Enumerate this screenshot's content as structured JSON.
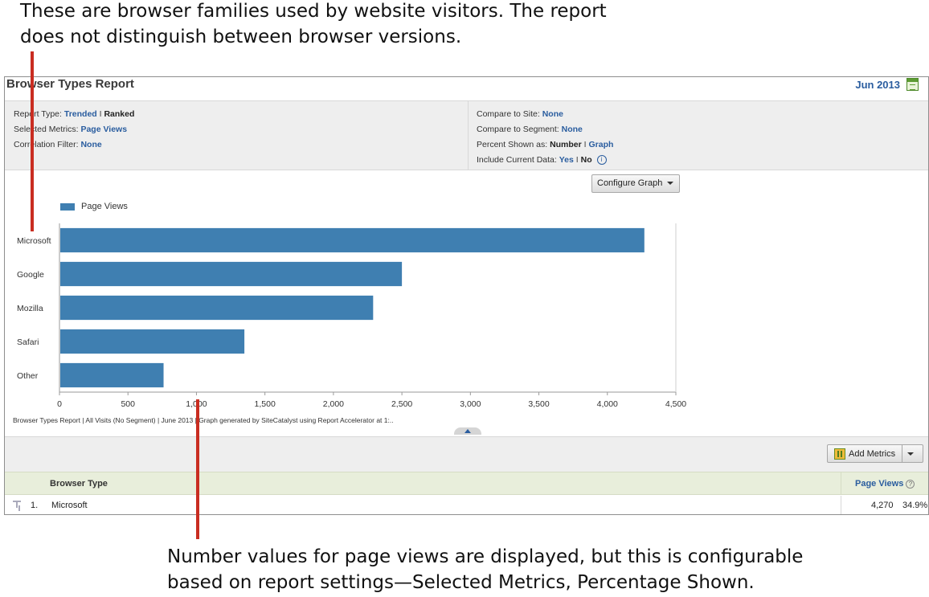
{
  "callouts": {
    "top_line1": "These are browser families used by website visitors. The report",
    "top_line2": "does not distinguish between browser versions.",
    "bottom_line1": "Number values for page views are displayed, but this is configurable",
    "bottom_line2": "based on report settings—Selected Metrics, Percentage Shown."
  },
  "report": {
    "title": "Browser Types Report",
    "date": "Jun 2013",
    "calendar_icon": "calendar-icon"
  },
  "settings": {
    "report_type_label": "Report Type:",
    "report_type_trended": "Trended",
    "report_type_sep": " I ",
    "report_type_ranked": "Ranked",
    "selected_metrics_label": "Selected Metrics:",
    "selected_metrics_value": "Page Views",
    "correlation_filter_label": "Correlation Filter:",
    "correlation_filter_value": "None",
    "compare_site_label": "Compare to Site:",
    "compare_site_value": "None",
    "compare_segment_label": "Compare to Segment:",
    "compare_segment_value": "None",
    "percent_shown_label": "Percent Shown as:",
    "percent_shown_number": "Number",
    "percent_shown_sep": " I ",
    "percent_shown_graph": "Graph",
    "include_current_label": "Include Current Data:",
    "include_current_yes": "Yes",
    "include_current_sep": " I ",
    "include_current_no": "No",
    "info_glyph": "i"
  },
  "configure_graph": {
    "label": "Configure Graph"
  },
  "chart_data": {
    "type": "bar",
    "orientation": "horizontal",
    "categories": [
      "Microsoft",
      "Google",
      "Mozilla",
      "Safari",
      "Other"
    ],
    "series": [
      {
        "name": "Page Views",
        "values": [
          4270,
          2500,
          2290,
          1350,
          760
        ],
        "color": "#3f7fb1"
      }
    ],
    "xlim": [
      0,
      4500
    ],
    "x_ticks": [
      "0",
      "500",
      "1,000",
      "1,500",
      "2,000",
      "2,500",
      "3,000",
      "3,500",
      "4,000",
      "4,500"
    ],
    "grid": false,
    "legend_position": "top-left",
    "footer": "Browser Types Report | All Visits (No Segment) | June 2013 | Graph generated by SiteCatalyst using Report Accelerator at  1:.."
  },
  "toolbar": {
    "add_metrics_label": "Add Metrics",
    "add_metrics_icon": "add-metrics-icon"
  },
  "table": {
    "columns": {
      "browser_type": "Browser Type",
      "page_views": "Page Views",
      "help_glyph": "?"
    },
    "rows": [
      {
        "rank": "1.",
        "name": "Microsoft",
        "value": "4,270",
        "percent": "34.9%"
      }
    ]
  },
  "colors": {
    "accent": "#2a5d9f",
    "bar": "#3f7fb1",
    "callout_line": "#c92d21",
    "header_bg": "#e8eedb"
  }
}
